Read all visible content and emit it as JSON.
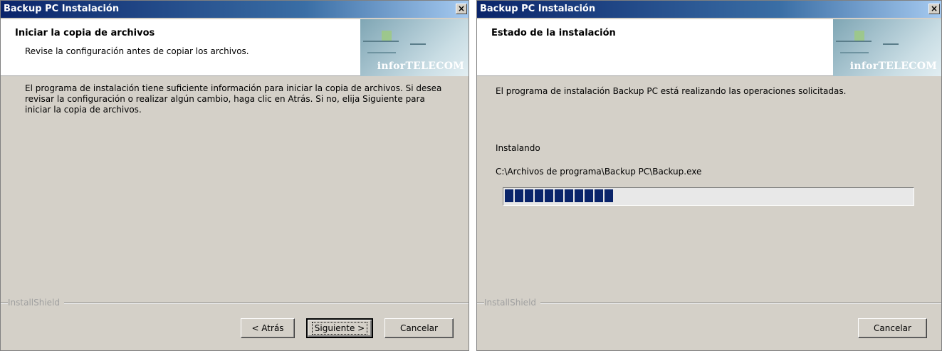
{
  "left": {
    "window_title": "Backup PC Instalación",
    "close_glyph": "×",
    "header_title": "Iniciar la copia de archivos",
    "header_subtitle": "Revise la configuración antes de copiar los archivos.",
    "logo_text": "inforTELECOM",
    "body_text": "El programa de instalación tiene suficiente información para iniciar la copia de archivos.  Si desea revisar la configuración o realizar algún cambio, haga clic en Atrás.  Si no, elija Siguiente para iniciar la copia de archivos.",
    "brand": "InstallShield",
    "buttons": {
      "back": "< Atrás",
      "next": "Siguiente >",
      "cancel": "Cancelar"
    }
  },
  "right": {
    "window_title": "Backup PC Instalación",
    "close_glyph": "×",
    "header_title": "Estado de la instalación",
    "logo_text": "inforTELECOM",
    "body_text": "El programa de instalación Backup PC está realizando las operaciones solicitadas.",
    "status_label": "Instalando",
    "file_path": "C:\\Archivos de programa\\Backup PC\\Backup.exe",
    "progress": {
      "filled_blocks": 11,
      "fraction": 0.3
    },
    "brand": "InstallShield",
    "buttons": {
      "cancel": "Cancelar"
    }
  },
  "colors": {
    "titlebar_start": "#0a246a",
    "dialog_bg": "#d4d0c8",
    "progress_block": "#0a246a"
  }
}
